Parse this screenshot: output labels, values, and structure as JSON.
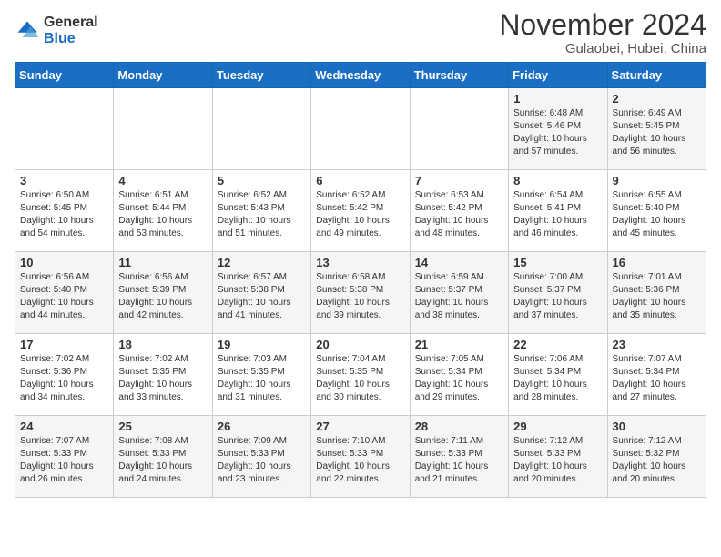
{
  "header": {
    "logo_general": "General",
    "logo_blue": "Blue",
    "month_title": "November 2024",
    "subtitle": "Gulaobei, Hubei, China"
  },
  "weekdays": [
    "Sunday",
    "Monday",
    "Tuesday",
    "Wednesday",
    "Thursday",
    "Friday",
    "Saturday"
  ],
  "weeks": [
    [
      {
        "day": "",
        "info": ""
      },
      {
        "day": "",
        "info": ""
      },
      {
        "day": "",
        "info": ""
      },
      {
        "day": "",
        "info": ""
      },
      {
        "day": "",
        "info": ""
      },
      {
        "day": "1",
        "info": "Sunrise: 6:48 AM\nSunset: 5:46 PM\nDaylight: 10 hours and 57 minutes."
      },
      {
        "day": "2",
        "info": "Sunrise: 6:49 AM\nSunset: 5:45 PM\nDaylight: 10 hours and 56 minutes."
      }
    ],
    [
      {
        "day": "3",
        "info": "Sunrise: 6:50 AM\nSunset: 5:45 PM\nDaylight: 10 hours and 54 minutes."
      },
      {
        "day": "4",
        "info": "Sunrise: 6:51 AM\nSunset: 5:44 PM\nDaylight: 10 hours and 53 minutes."
      },
      {
        "day": "5",
        "info": "Sunrise: 6:52 AM\nSunset: 5:43 PM\nDaylight: 10 hours and 51 minutes."
      },
      {
        "day": "6",
        "info": "Sunrise: 6:52 AM\nSunset: 5:42 PM\nDaylight: 10 hours and 49 minutes."
      },
      {
        "day": "7",
        "info": "Sunrise: 6:53 AM\nSunset: 5:42 PM\nDaylight: 10 hours and 48 minutes."
      },
      {
        "day": "8",
        "info": "Sunrise: 6:54 AM\nSunset: 5:41 PM\nDaylight: 10 hours and 46 minutes."
      },
      {
        "day": "9",
        "info": "Sunrise: 6:55 AM\nSunset: 5:40 PM\nDaylight: 10 hours and 45 minutes."
      }
    ],
    [
      {
        "day": "10",
        "info": "Sunrise: 6:56 AM\nSunset: 5:40 PM\nDaylight: 10 hours and 44 minutes."
      },
      {
        "day": "11",
        "info": "Sunrise: 6:56 AM\nSunset: 5:39 PM\nDaylight: 10 hours and 42 minutes."
      },
      {
        "day": "12",
        "info": "Sunrise: 6:57 AM\nSunset: 5:38 PM\nDaylight: 10 hours and 41 minutes."
      },
      {
        "day": "13",
        "info": "Sunrise: 6:58 AM\nSunset: 5:38 PM\nDaylight: 10 hours and 39 minutes."
      },
      {
        "day": "14",
        "info": "Sunrise: 6:59 AM\nSunset: 5:37 PM\nDaylight: 10 hours and 38 minutes."
      },
      {
        "day": "15",
        "info": "Sunrise: 7:00 AM\nSunset: 5:37 PM\nDaylight: 10 hours and 37 minutes."
      },
      {
        "day": "16",
        "info": "Sunrise: 7:01 AM\nSunset: 5:36 PM\nDaylight: 10 hours and 35 minutes."
      }
    ],
    [
      {
        "day": "17",
        "info": "Sunrise: 7:02 AM\nSunset: 5:36 PM\nDaylight: 10 hours and 34 minutes."
      },
      {
        "day": "18",
        "info": "Sunrise: 7:02 AM\nSunset: 5:35 PM\nDaylight: 10 hours and 33 minutes."
      },
      {
        "day": "19",
        "info": "Sunrise: 7:03 AM\nSunset: 5:35 PM\nDaylight: 10 hours and 31 minutes."
      },
      {
        "day": "20",
        "info": "Sunrise: 7:04 AM\nSunset: 5:35 PM\nDaylight: 10 hours and 30 minutes."
      },
      {
        "day": "21",
        "info": "Sunrise: 7:05 AM\nSunset: 5:34 PM\nDaylight: 10 hours and 29 minutes."
      },
      {
        "day": "22",
        "info": "Sunrise: 7:06 AM\nSunset: 5:34 PM\nDaylight: 10 hours and 28 minutes."
      },
      {
        "day": "23",
        "info": "Sunrise: 7:07 AM\nSunset: 5:34 PM\nDaylight: 10 hours and 27 minutes."
      }
    ],
    [
      {
        "day": "24",
        "info": "Sunrise: 7:07 AM\nSunset: 5:33 PM\nDaylight: 10 hours and 26 minutes."
      },
      {
        "day": "25",
        "info": "Sunrise: 7:08 AM\nSunset: 5:33 PM\nDaylight: 10 hours and 24 minutes."
      },
      {
        "day": "26",
        "info": "Sunrise: 7:09 AM\nSunset: 5:33 PM\nDaylight: 10 hours and 23 minutes."
      },
      {
        "day": "27",
        "info": "Sunrise: 7:10 AM\nSunset: 5:33 PM\nDaylight: 10 hours and 22 minutes."
      },
      {
        "day": "28",
        "info": "Sunrise: 7:11 AM\nSunset: 5:33 PM\nDaylight: 10 hours and 21 minutes."
      },
      {
        "day": "29",
        "info": "Sunrise: 7:12 AM\nSunset: 5:33 PM\nDaylight: 10 hours and 20 minutes."
      },
      {
        "day": "30",
        "info": "Sunrise: 7:12 AM\nSunset: 5:32 PM\nDaylight: 10 hours and 20 minutes."
      }
    ]
  ]
}
